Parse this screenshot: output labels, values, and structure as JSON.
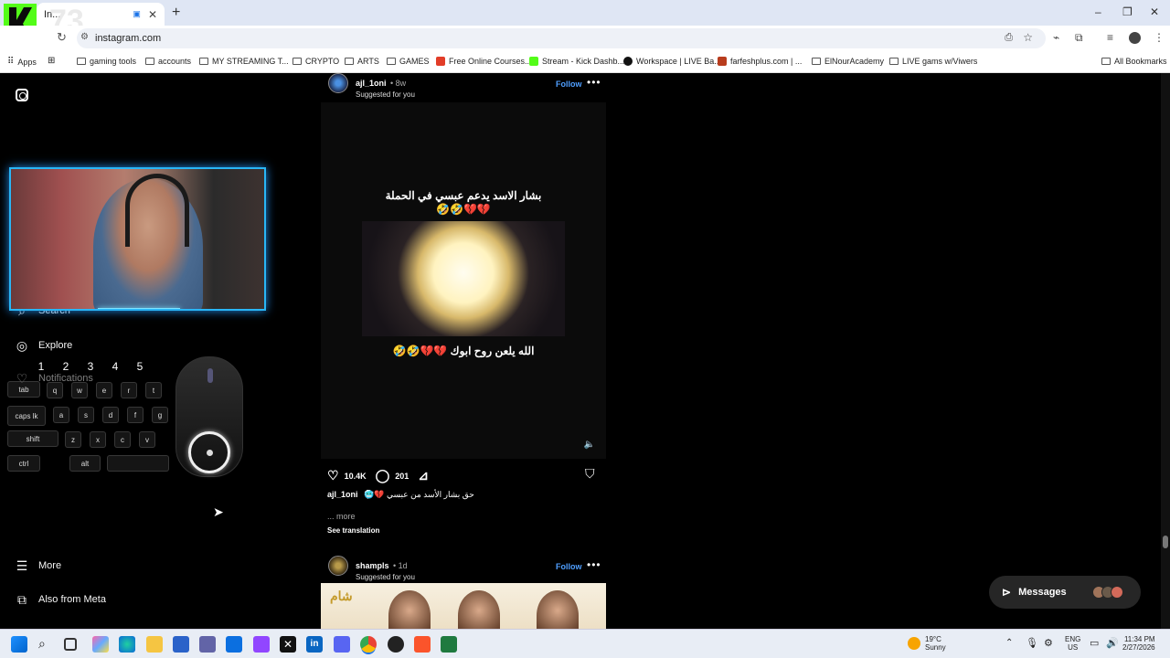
{
  "browser": {
    "tab_title": "In...",
    "address": "instagram.com",
    "new_tab": "+",
    "window_controls": [
      "–",
      "❐",
      "✕"
    ],
    "bookmarks": [
      {
        "label": "Apps",
        "kind": "apps"
      },
      {
        "label": "gaming tools",
        "kind": "folder"
      },
      {
        "label": "accounts",
        "kind": "folder"
      },
      {
        "label": "MY STREAMING T...",
        "kind": "folder"
      },
      {
        "label": "CRYPTO",
        "kind": "folder"
      },
      {
        "label": "ARTS",
        "kind": "folder"
      },
      {
        "label": "GAMES",
        "kind": "folder"
      },
      {
        "label": "Free Online Courses...",
        "kind": "site",
        "color": "#e23d28"
      },
      {
        "label": "Stream - Kick Dashb...",
        "kind": "site",
        "color": "#53fc18"
      },
      {
        "label": "Workspace | LIVE Ba...",
        "kind": "site",
        "color": "#111111"
      },
      {
        "label": "farfeshplus.com | ...",
        "kind": "site",
        "color": "#b83c1d"
      },
      {
        "label": "ElNourAcademy",
        "kind": "folder"
      },
      {
        "label": "LIVE gams w/Viwers",
        "kind": "folder"
      }
    ],
    "all_bookmarks": "All Bookmarks"
  },
  "overlay": {
    "counter": "73"
  },
  "sidebar": {
    "search": "Search",
    "explore": "Explore",
    "notifications": "Notifications",
    "more": "More",
    "also_from_meta": "Also from Meta"
  },
  "keyboard": {
    "numbers": [
      "1",
      "2",
      "3",
      "4",
      "5"
    ],
    "row_q": [
      "tab",
      "q",
      "w",
      "e",
      "r",
      "t"
    ],
    "row_a": [
      "caps lk",
      "a",
      "s",
      "d",
      "f",
      "g"
    ],
    "row_z": [
      "shift",
      "z",
      "x",
      "c",
      "v"
    ],
    "row_ctrl": [
      "ctrl",
      "alt",
      ""
    ]
  },
  "post1": {
    "username": "ajl_1oni",
    "age": "• 8w",
    "suggested": "Suggested for you",
    "follow": "Follow",
    "video_top_text": "بشار الاسد يدعم عبسي في الحملة",
    "video_top_emoji": "💔💔🤣🤣",
    "video_bottom_text": "الله يلعن روح ابوك 💔💔🤣🤣",
    "likes": "10.4K",
    "comments": "201",
    "caption_user": "ajl_1oni",
    "caption_text": "🥶💔 حق بشار الأسد من عبسي",
    "more": "... more",
    "see_translation": "See translation"
  },
  "post2": {
    "username": "shampls",
    "age": "• 1d",
    "suggested": "Suggested for you",
    "follow": "Follow",
    "thumb_logo": "شام"
  },
  "messages": {
    "label": "Messages"
  },
  "taskbar": {
    "weather_temp": "19°C",
    "weather_desc": "Sunny",
    "lang": "ENG",
    "region": "US",
    "time": "11:34 PM",
    "date": "2/27/2026"
  }
}
